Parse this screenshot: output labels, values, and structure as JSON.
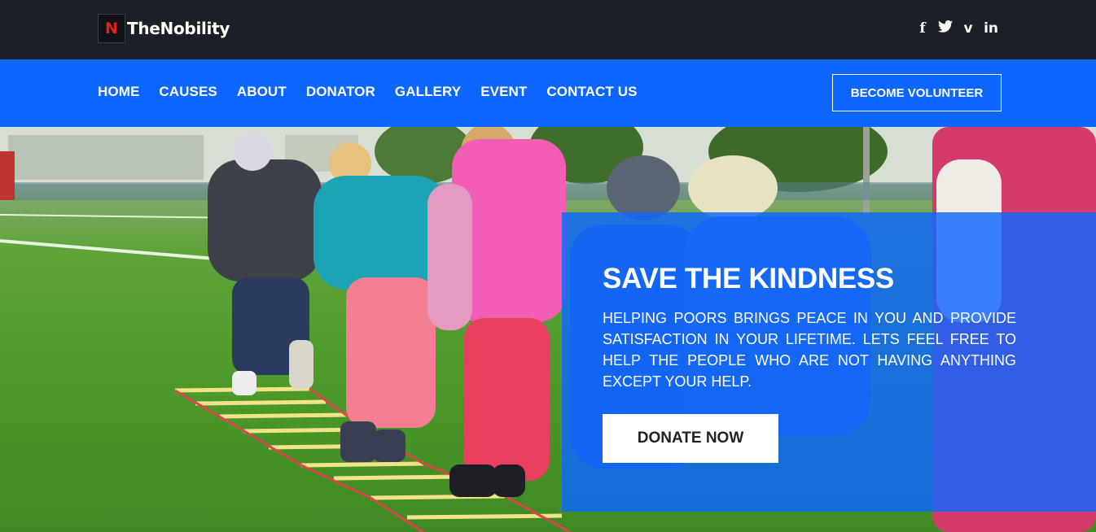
{
  "brand": {
    "mark": "N",
    "name": "TheNobility"
  },
  "social": [
    {
      "icon": "facebook-icon",
      "glyph": "f"
    },
    {
      "icon": "twitter-icon",
      "glyph": "🐦"
    },
    {
      "icon": "vimeo-icon",
      "glyph": "v"
    },
    {
      "icon": "linkedin-icon",
      "glyph": "in"
    }
  ],
  "nav": {
    "items": [
      "HOME",
      "CAUSES",
      "ABOUT",
      "DONATOR",
      "GALLERY",
      "EVENT",
      "CONTACT US"
    ],
    "cta": "BECOME VOLUNTEER"
  },
  "hero": {
    "title": "SAVE THE KINDNESS",
    "text": "HELPING POORS BRINGS PEACE IN YOU AND PROVIDE SATISFACTION IN YOUR LIFETIME. LETS FEEL FREE TO HELP THE PEOPLE WHO ARE NOT HAVING ANYTHING EXCEPT YOUR HELP.",
    "button": "DONATE NOW"
  },
  "colors": {
    "topbar": "#1b1f27",
    "navbar": "#0d66ff",
    "logo_accent": "#e2231a"
  }
}
